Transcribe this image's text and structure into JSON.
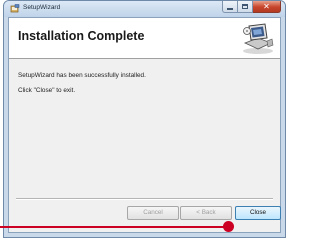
{
  "window": {
    "title": "SetupWizard",
    "caption_icons": [
      "minimize-icon",
      "maximize-icon",
      "close-icon"
    ],
    "close_glyph": "✕"
  },
  "header": {
    "title": "Installation Complete",
    "art_icon": "computer-setup-icon"
  },
  "body": {
    "message": "SetupWizard has been successfully installed.",
    "instruction": "Click \"Close\" to exit."
  },
  "buttons": {
    "cancel_label": "Cancel",
    "back_label": "< Back",
    "close_label": "Close"
  },
  "colors": {
    "pointer": "#cc0022",
    "close_caption": "#c7452b",
    "accent_button": "#3c7fb1"
  }
}
